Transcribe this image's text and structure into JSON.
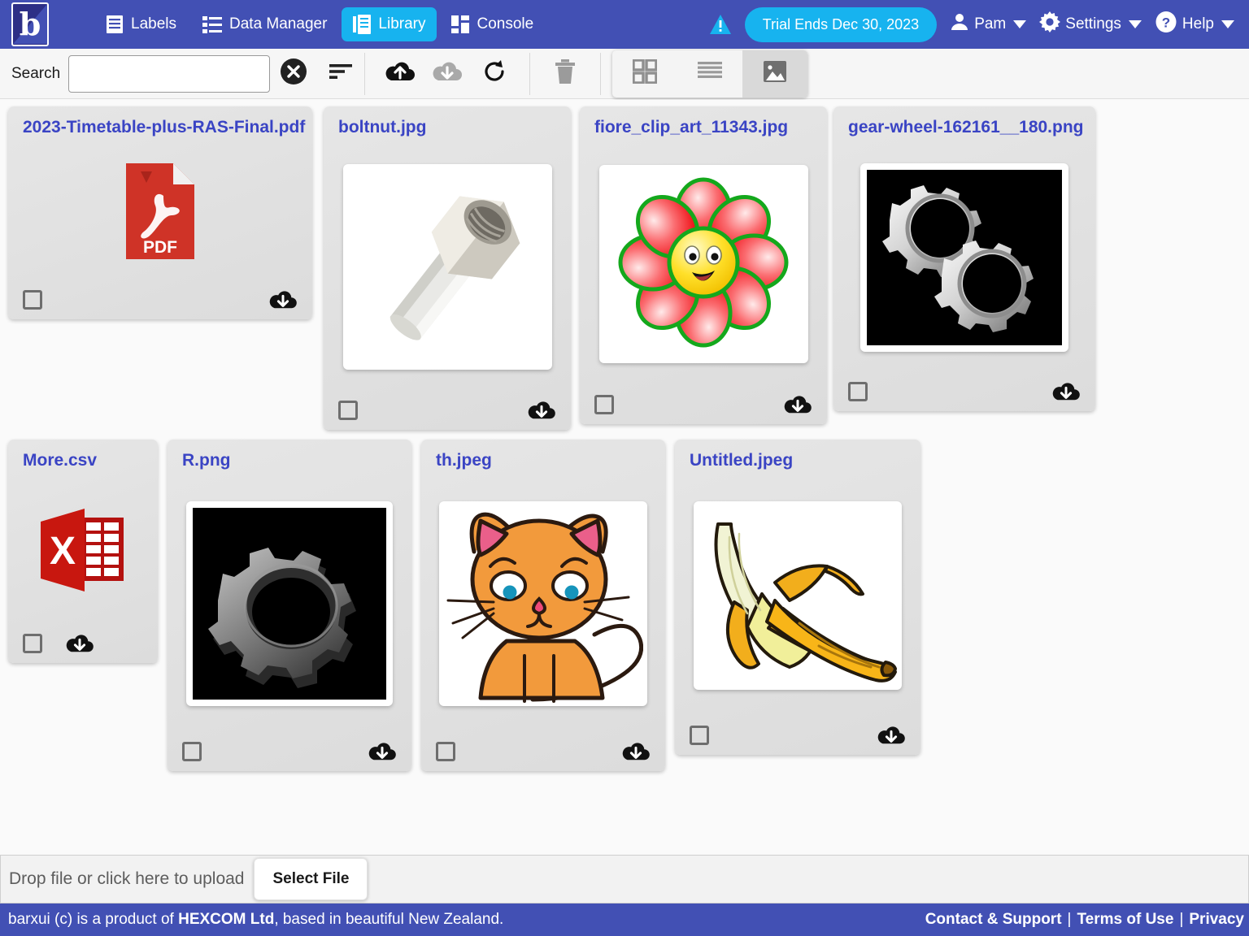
{
  "app": {
    "logo_letter": "b",
    "brand_color": "#4250b4",
    "accent_color": "#17b3ef",
    "link_color": "#3a44c4"
  },
  "header": {
    "nav": [
      {
        "label": "Labels",
        "icon": "labels-icon",
        "active": false
      },
      {
        "label": "Data Manager",
        "icon": "list-icon",
        "active": false
      },
      {
        "label": "Library",
        "icon": "library-icon",
        "active": true
      },
      {
        "label": "Console",
        "icon": "dashboard-icon",
        "active": false
      }
    ],
    "warning_icon": "warning-triangle-icon",
    "trial_label": "Trial Ends Dec 30, 2023",
    "user_menu": {
      "label": "Pam",
      "icon": "person-icon"
    },
    "settings_menu": {
      "label": "Settings",
      "icon": "gear-icon"
    },
    "help_menu": {
      "label": "Help",
      "icon": "question-circle-icon"
    }
  },
  "toolbar": {
    "search_label": "Search",
    "search_value": "",
    "search_placeholder": "",
    "clear_button": "clear-search-icon",
    "sort_button": "sort-icon",
    "upload_button": "cloud-upload-icon",
    "download_button": "cloud-download-icon",
    "refresh_button": "refresh-icon",
    "delete_button": "trash-icon",
    "views": [
      {
        "name": "grid-view",
        "icon": "grid-icon",
        "active": false
      },
      {
        "name": "list-view",
        "icon": "list-lines-icon",
        "active": false
      },
      {
        "name": "image-view",
        "icon": "image-icon",
        "active": true
      }
    ]
  },
  "library": {
    "rows": [
      {
        "files": [
          {
            "name": "2023-Timetable-plus-RAS-Final.pdf",
            "type": "pdf",
            "checked": false,
            "download_icon": "cloud-download-icon"
          },
          {
            "name": "boltnut.jpg",
            "type": "image-boltnut",
            "checked": false,
            "download_icon": "cloud-download-icon"
          },
          {
            "name": "fiore_clip_art_11343.jpg",
            "type": "image-flower",
            "checked": false,
            "download_icon": "cloud-download-icon"
          },
          {
            "name": "gear-wheel-162161__180.png",
            "type": "image-gears",
            "checked": false,
            "download_icon": "cloud-download-icon"
          }
        ]
      },
      {
        "files": [
          {
            "name": "More.csv",
            "type": "csv",
            "checked": false,
            "download_icon": "cloud-download-icon"
          },
          {
            "name": "R.png",
            "type": "image-gear-single",
            "checked": false,
            "download_icon": "cloud-download-icon"
          },
          {
            "name": "th.jpeg",
            "type": "image-cat",
            "checked": false,
            "download_icon": "cloud-download-icon"
          },
          {
            "name": "Untitled.jpeg",
            "type": "image-banana",
            "checked": false,
            "download_icon": "cloud-download-icon"
          }
        ]
      }
    ],
    "pdf_badge": "PDF",
    "csv_badge": "X"
  },
  "upload": {
    "drop_text": "Drop file or click here to upload",
    "select_file_label": "Select File"
  },
  "footer": {
    "copy_prefix": "barxui (c) is a product of ",
    "company": "HEXCOM Ltd",
    "copy_suffix": ", based in beautiful New Zealand.",
    "links": [
      {
        "label": "Contact & Support"
      },
      {
        "label": "Terms of Use"
      },
      {
        "label": "Privacy"
      }
    ],
    "separator": "|"
  }
}
